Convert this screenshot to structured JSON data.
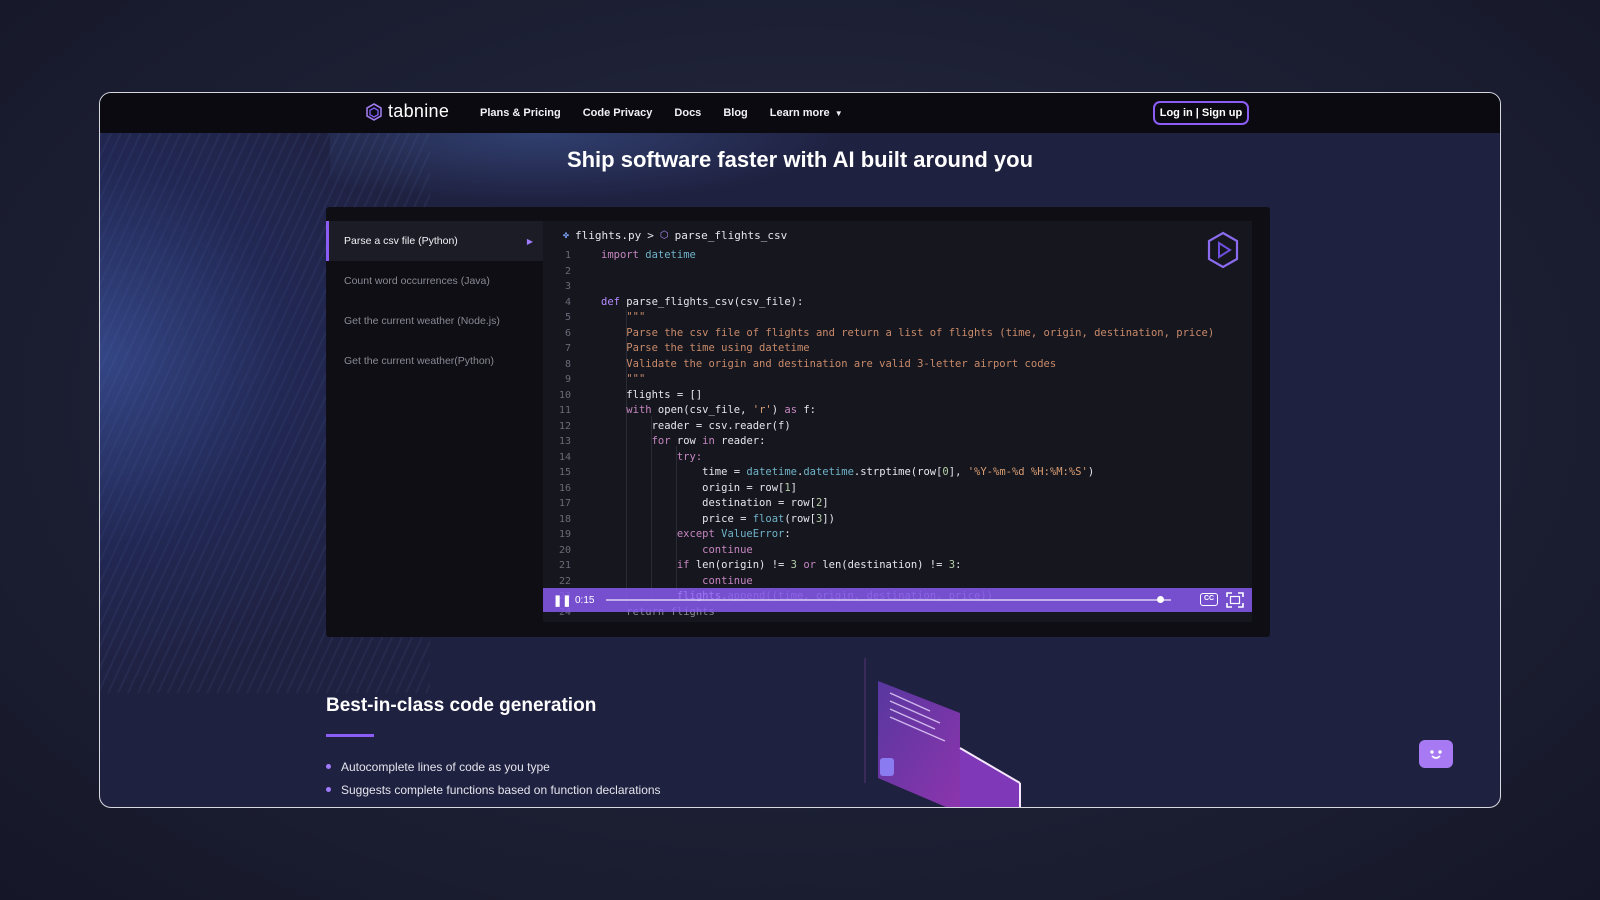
{
  "nav": {
    "logo_text": "tabnine",
    "links": [
      "Plans & Pricing",
      "Code Privacy",
      "Docs",
      "Blog"
    ],
    "learn_more": "Learn more",
    "auth_button": "Log in | Sign up"
  },
  "hero": {
    "title": "Ship software faster with AI built around you"
  },
  "examples": [
    "Parse a csv file (Python)",
    "Count word occurrences (Java)",
    "Get the current weather (Node.js)",
    "Get the current weather(Python)"
  ],
  "editor": {
    "file": "flights.py",
    "separator": ">",
    "function": "parse_flights_csv",
    "line_numbers": [
      "1",
      "2",
      "3",
      "4",
      "5",
      "6",
      "7",
      "8",
      "9",
      "10",
      "11",
      "12",
      "13",
      "14",
      "15",
      "16",
      "17",
      "18",
      "19",
      "20",
      "21",
      "22",
      "23",
      "24"
    ]
  },
  "player": {
    "time": "0:15",
    "progress_fraction": 0.98,
    "cc_label": "CC"
  },
  "features": {
    "title": "Best-in-class code generation",
    "bullets": [
      "Autocomplete lines of code as you type",
      "Suggests complete functions based on function declarations"
    ]
  },
  "colors": {
    "accent": "#8b5cf6",
    "background": "#1f2140",
    "editor_bg": "#16161e"
  }
}
